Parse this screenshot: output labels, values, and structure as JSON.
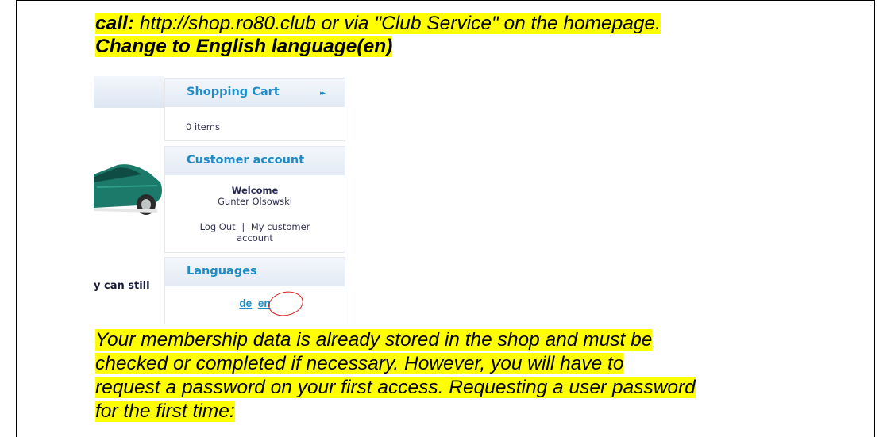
{
  "intro": {
    "call_label": "call:",
    "call_text": " http://shop.ro80.club or via \"Club Service\" on the homepage.",
    "change_lang": "Change to English language(en)"
  },
  "shop": {
    "left_text": "y can still",
    "cart": {
      "title": "Shopping Cart",
      "arrow": "▸▸",
      "items": "0 items"
    },
    "account": {
      "title": "Customer account",
      "welcome": "Welcome",
      "user": "Gunter Olsowski",
      "logout": "Log Out",
      "separator": "|",
      "my_account_line1": "My customer",
      "my_account_line2": "account"
    },
    "languages": {
      "title": "Languages",
      "de": "de",
      "en": "en"
    }
  },
  "paragraph": {
    "lines": [
      "Your membership data is already stored in the shop and must be",
      "checked or completed if necessary. However, you will have to",
      "request a password on your first access. Requesting a user password",
      "for the first time:"
    ]
  }
}
